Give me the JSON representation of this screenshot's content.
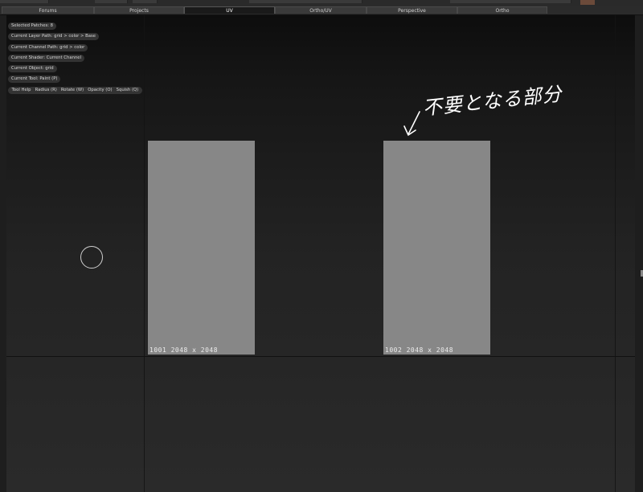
{
  "tabs": [
    {
      "label": "Forums",
      "active": false
    },
    {
      "label": "Projects",
      "active": false
    },
    {
      "label": "UV",
      "active": true
    },
    {
      "label": "Ortho/UV",
      "active": false
    },
    {
      "label": "Perspective",
      "active": false
    },
    {
      "label": "Ortho",
      "active": false
    }
  ],
  "info": {
    "selected_patches": "Selected Patches: 8",
    "layer_path": "Current Layer Path: grid > color > Base",
    "channel_path": "Current Channel Path: grid > color",
    "shader": "Current Shader: Current Channel",
    "object": "Current Object: grid",
    "tool": "Current Tool: Paint (P)"
  },
  "tool_buttons": [
    {
      "label": "Tool Help"
    },
    {
      "label": "Radius (R)"
    },
    {
      "label": "Rotate (W)"
    },
    {
      "label": "Opacity (O)"
    },
    {
      "label": "Squish (Q)"
    }
  ],
  "patches": [
    {
      "label": "1001  2048 x 2048",
      "color": "#878787"
    },
    {
      "label": "1002  2048 x 2048",
      "color": "#878787"
    }
  ],
  "annotation": {
    "arrow_icon": "hand-drawn-arrow-icon",
    "text": "不要となる部分"
  },
  "colors": {
    "background": "#1e1e1e",
    "patch": "#878787",
    "pill": "#333333"
  }
}
